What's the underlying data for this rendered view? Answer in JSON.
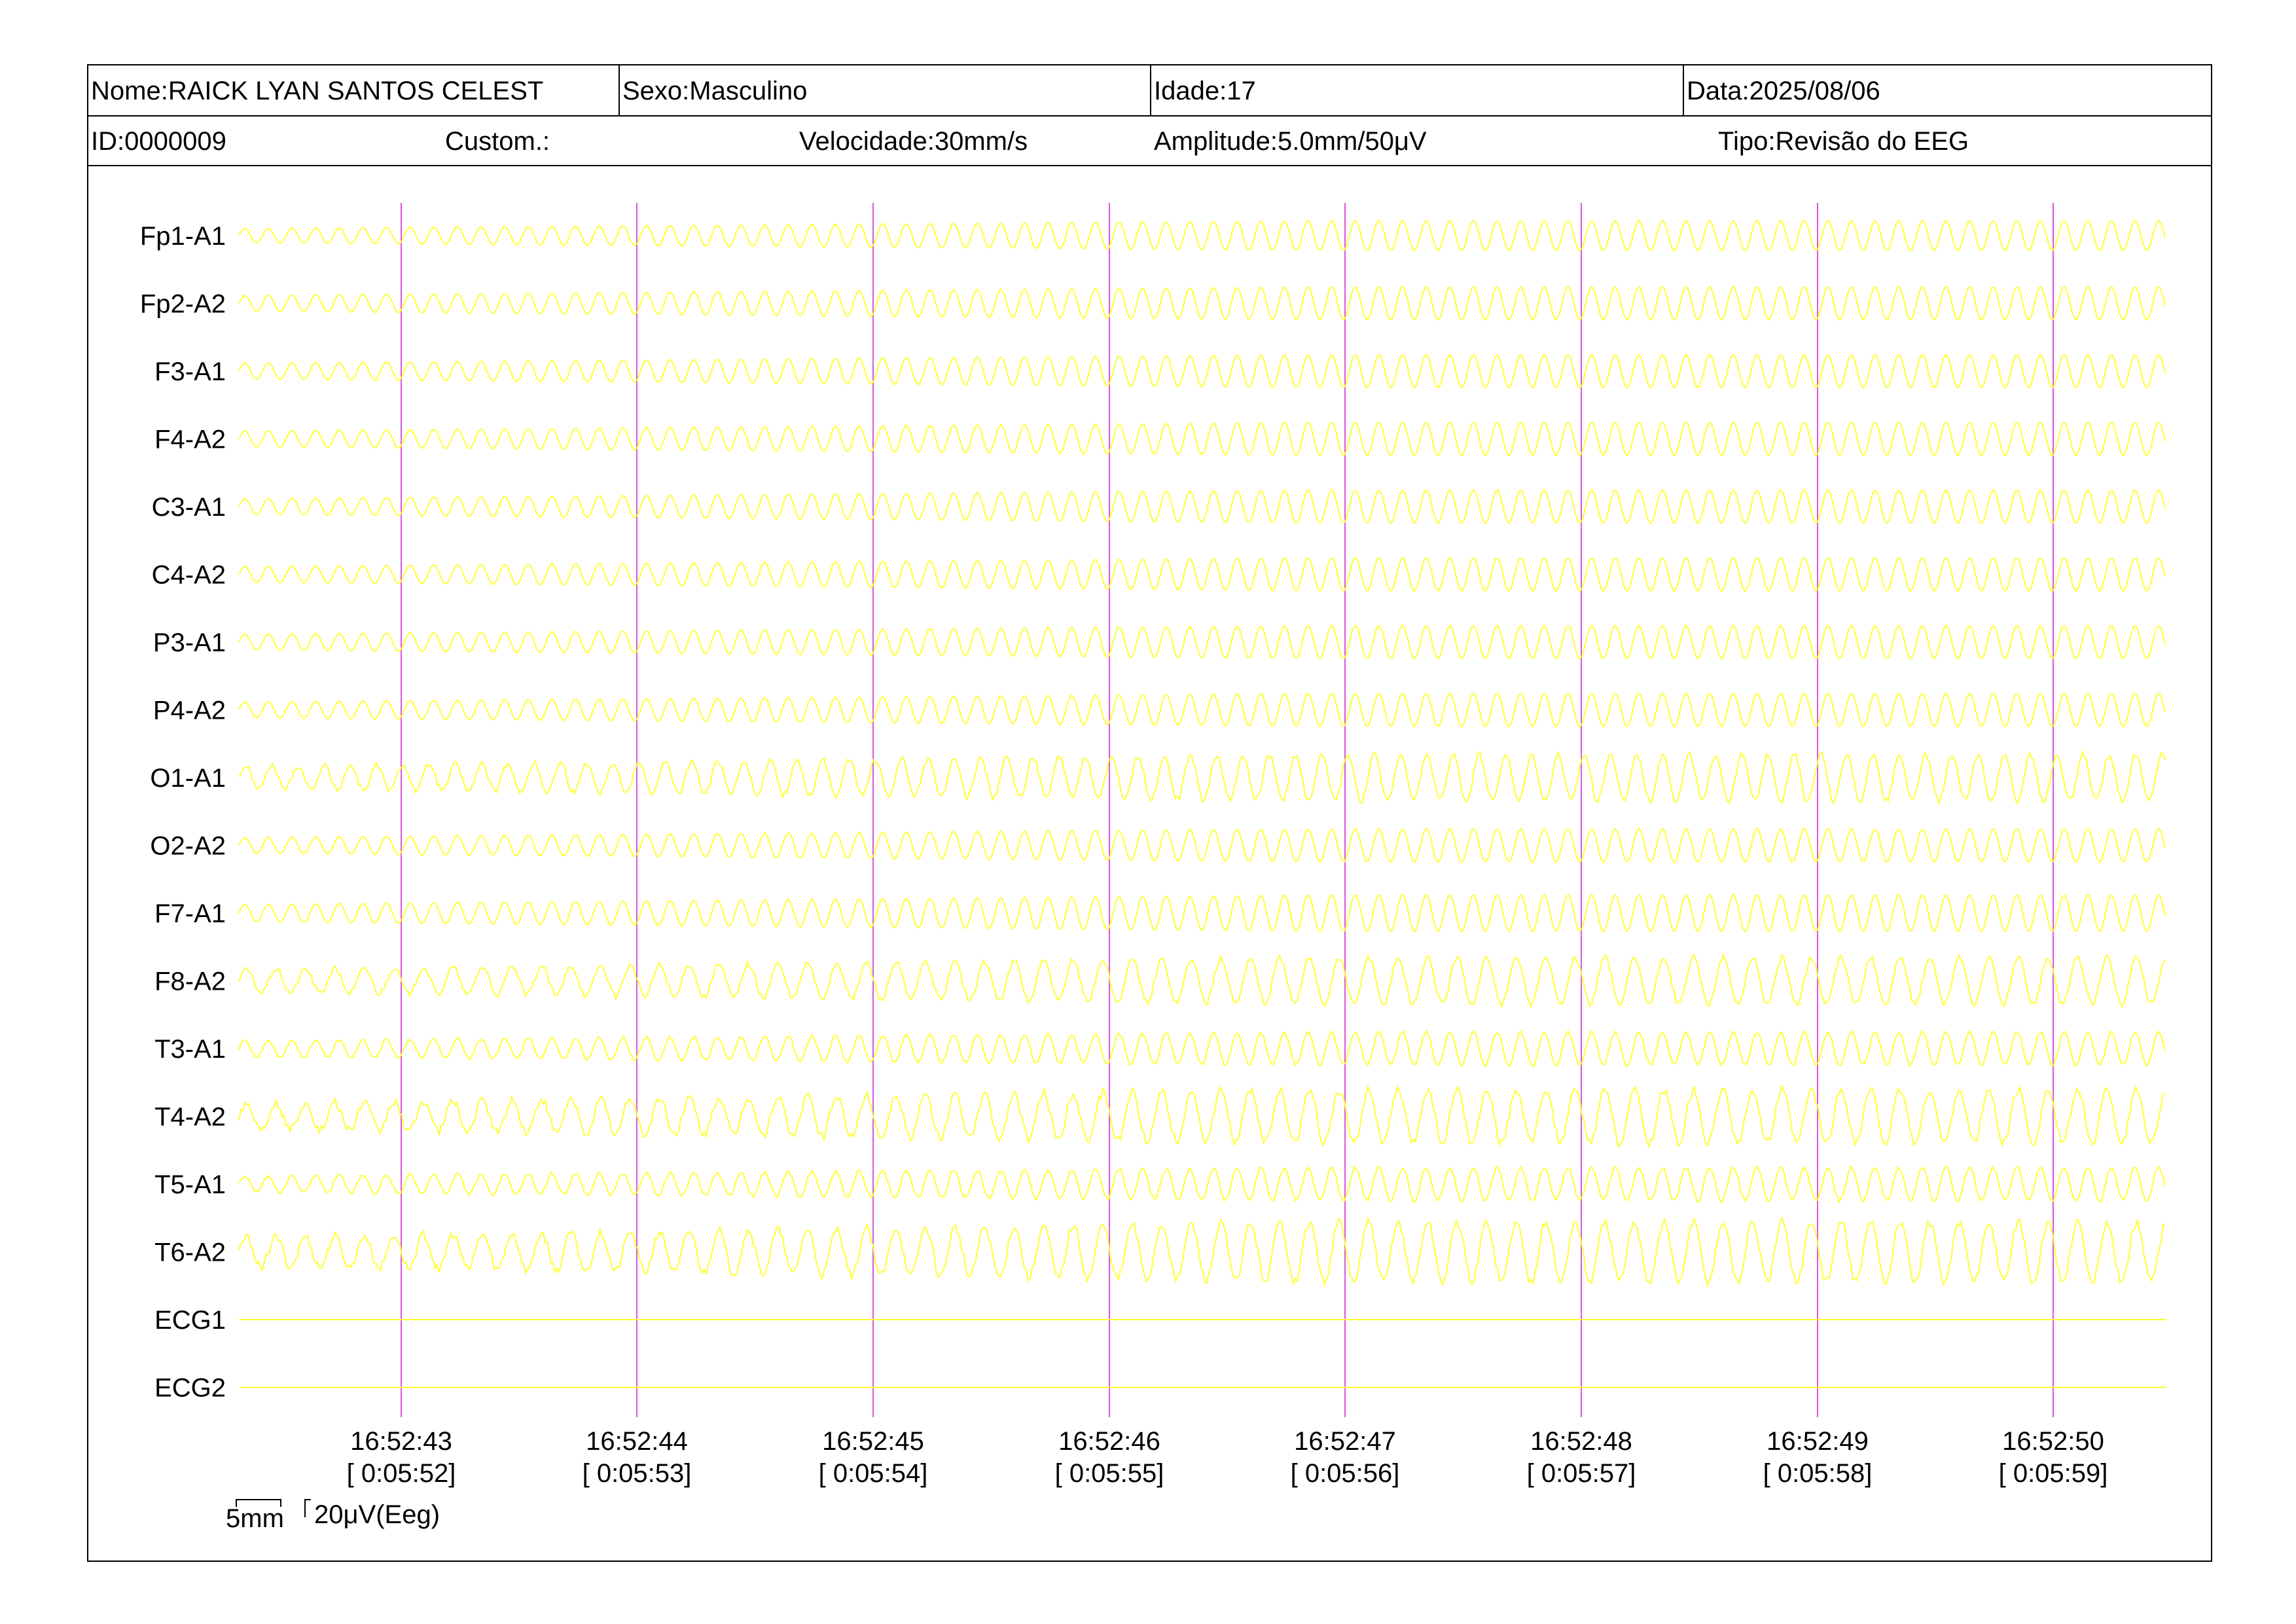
{
  "header": {
    "nome": "Nome:RAICK LYAN SANTOS CELEST",
    "sexo": "Sexo:Masculino",
    "idade": "Idade:17",
    "data": "Data:2025/08/06",
    "id": "ID:0000009",
    "custom": "Custom.:",
    "velocidade": "Velocidade:30mm/s",
    "amplitude": "Amplitude:5.0mm/50μV",
    "tipo": "Tipo:Revisão do EEG"
  },
  "channels": [
    {
      "label": "Fp1-A1",
      "amp": 0.9,
      "freq": 10,
      "irregular": 0.05
    },
    {
      "label": "Fp2-A2",
      "amp": 1.0,
      "freq": 10,
      "irregular": 0.0
    },
    {
      "label": "F3-A1",
      "amp": 1.0,
      "freq": 10,
      "irregular": 0.0
    },
    {
      "label": "F4-A2",
      "amp": 1.0,
      "freq": 10,
      "irregular": 0.0
    },
    {
      "label": "C3-A1",
      "amp": 1.0,
      "freq": 10,
      "irregular": 0.0
    },
    {
      "label": "C4-A2",
      "amp": 1.0,
      "freq": 10,
      "irregular": 0.0
    },
    {
      "label": "P3-A1",
      "amp": 1.0,
      "freq": 10,
      "irregular": 0.0
    },
    {
      "label": "P4-A2",
      "amp": 1.0,
      "freq": 10,
      "irregular": 0.0
    },
    {
      "label": "O1-A1",
      "amp": 1.4,
      "freq": 9,
      "irregular": 0.6
    },
    {
      "label": "O2-A2",
      "amp": 1.0,
      "freq": 10,
      "irregular": 0.1
    },
    {
      "label": "F7-A1",
      "amp": 1.1,
      "freq": 10,
      "irregular": 0.05
    },
    {
      "label": "F8-A2",
      "amp": 1.4,
      "freq": 8,
      "irregular": 0.6
    },
    {
      "label": "T3-A1",
      "amp": 1.0,
      "freq": 10,
      "irregular": 0.3
    },
    {
      "label": "T4-A2",
      "amp": 1.6,
      "freq": 8,
      "irregular": 0.9
    },
    {
      "label": "T5-A1",
      "amp": 1.0,
      "freq": 10,
      "irregular": 0.35
    },
    {
      "label": "T6-A2",
      "amp": 1.8,
      "freq": 8,
      "irregular": 0.9
    },
    {
      "label": "ECG1",
      "amp": 0,
      "freq": 0,
      "irregular": 0
    },
    {
      "label": "ECG2",
      "amp": 0,
      "freq": 0,
      "irregular": 0
    }
  ],
  "time_marks": [
    {
      "clock": "16:52:43",
      "elapsed": "[ 0:05:52]"
    },
    {
      "clock": "16:52:44",
      "elapsed": "[ 0:05:53]"
    },
    {
      "clock": "16:52:45",
      "elapsed": "[ 0:05:54]"
    },
    {
      "clock": "16:52:46",
      "elapsed": "[ 0:05:55]"
    },
    {
      "clock": "16:52:47",
      "elapsed": "[ 0:05:56]"
    },
    {
      "clock": "16:52:48",
      "elapsed": "[ 0:05:57]"
    },
    {
      "clock": "16:52:49",
      "elapsed": "[ 0:05:58]"
    },
    {
      "clock": "16:52:50",
      "elapsed": "[ 0:05:59]"
    }
  ],
  "scale": {
    "time_label": "5mm",
    "amp_label": "20μV(Eeg)"
  },
  "colors": {
    "trace": "#ffff33",
    "marker": "#dd55dd"
  }
}
